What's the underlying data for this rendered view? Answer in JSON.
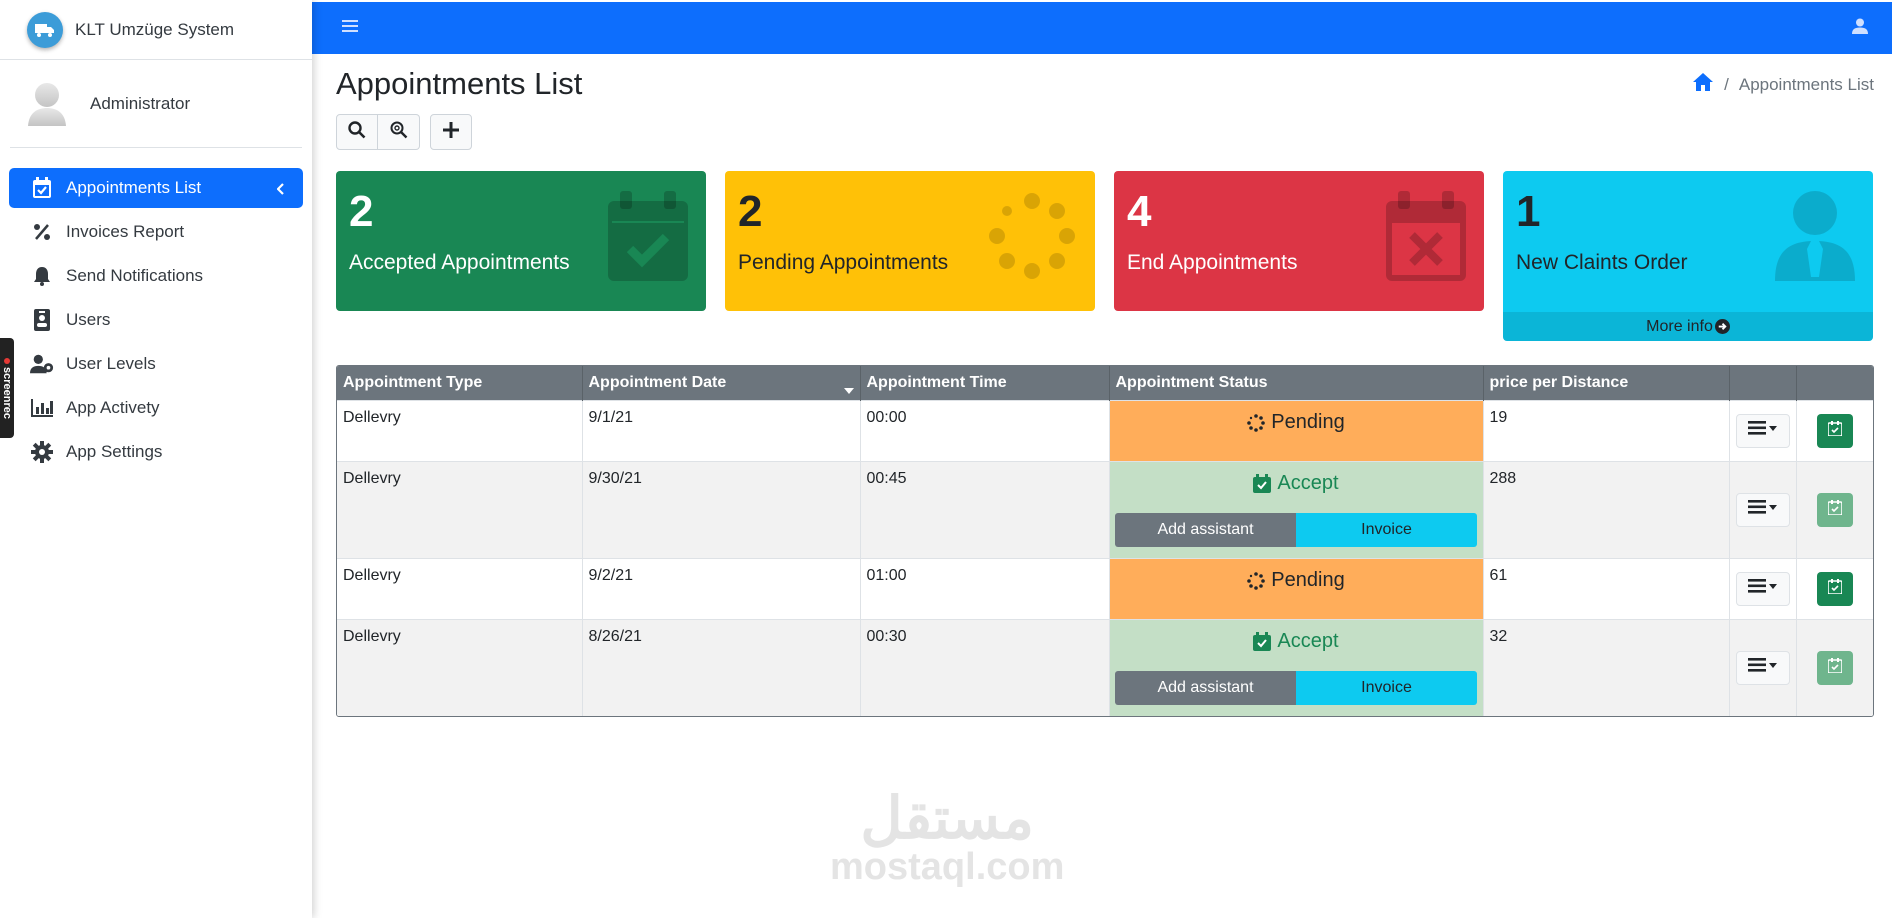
{
  "brand": {
    "title": "KLT Umzüge System"
  },
  "user": {
    "name": "Administrator"
  },
  "sidebar": {
    "items": [
      {
        "label": "Appointments List",
        "icon": "calendar-check-icon",
        "active": true
      },
      {
        "label": "Invoices Report",
        "icon": "percent-icon"
      },
      {
        "label": "Send Notifications",
        "icon": "bell-icon"
      },
      {
        "label": "Users",
        "icon": "id-badge-icon"
      },
      {
        "label": "User Levels",
        "icon": "user-cog-icon"
      },
      {
        "label": "App Activety",
        "icon": "chart-bar-icon"
      },
      {
        "label": "App Settings",
        "icon": "gear-icon"
      }
    ]
  },
  "recorder": {
    "label": "screenrec"
  },
  "page": {
    "title": "Appointments List"
  },
  "breadcrumb": {
    "current": "Appointments List",
    "separator": "/"
  },
  "cards": [
    {
      "value": "2",
      "label": "Accepted Appointments",
      "color": "#198754"
    },
    {
      "value": "2",
      "label": "Pending Appointments",
      "color": "#ffc107"
    },
    {
      "value": "4",
      "label": "End Appointments",
      "color": "#dc3545"
    },
    {
      "value": "1",
      "label": "New Claints Order",
      "color": "#0dcaf0",
      "more": "More info"
    }
  ],
  "table": {
    "headers": [
      "Appointment Type",
      "Appointment Date",
      "Appointment Time",
      "Appointment Status",
      "price per Distance",
      "",
      ""
    ],
    "rows": [
      {
        "type": "Dellevry",
        "date": "9/1/21",
        "time": "00:00",
        "status": "Pending",
        "price": "19"
      },
      {
        "type": "Dellevry",
        "date": "9/30/21",
        "time": "00:45",
        "status": "Accept",
        "price": "288",
        "assist": "Add assistant",
        "invoice": "Invoice"
      },
      {
        "type": "Dellevry",
        "date": "9/2/21",
        "time": "01:00",
        "status": "Pending",
        "price": "61"
      },
      {
        "type": "Dellevry",
        "date": "8/26/21",
        "time": "00:30",
        "status": "Accept",
        "price": "32",
        "assist": "Add assistant",
        "invoice": "Invoice"
      }
    ]
  },
  "watermark": {
    "arabic": "مستقل",
    "domain": "mostaql.com"
  },
  "colors": {
    "primary": "#0d6efd",
    "success": "#198754",
    "warning": "#ffc107",
    "danger": "#dc3545",
    "info": "#0dcaf0",
    "pending": "#ffad5a",
    "accept_bg": "#c4dfc6"
  }
}
